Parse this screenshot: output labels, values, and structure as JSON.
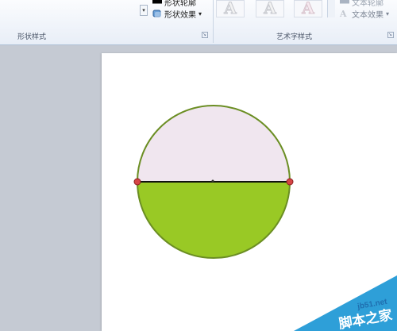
{
  "ribbon": {
    "shape_outline_label": "形状轮廓",
    "shape_effects_label": "形状效果",
    "shape_styles_group": "形状样式",
    "wordart_styles_group": "艺术字样式",
    "text_outline_label": "文本轮廓",
    "text_effects_label": "文本效果",
    "wordart_glyph": "A",
    "dropdown_arrow": "▾",
    "launcher_glyph": "↘"
  },
  "canvas": {
    "shape": "half-filled circle with horizontal diameter line",
    "top_half_color": "#f0e6ef",
    "bottom_half_color": "#99c925",
    "outline_color": "#6b8e23",
    "handle_color": "#cc3333"
  },
  "watermark": {
    "url": "jb51.net",
    "name": "脚本之家"
  }
}
